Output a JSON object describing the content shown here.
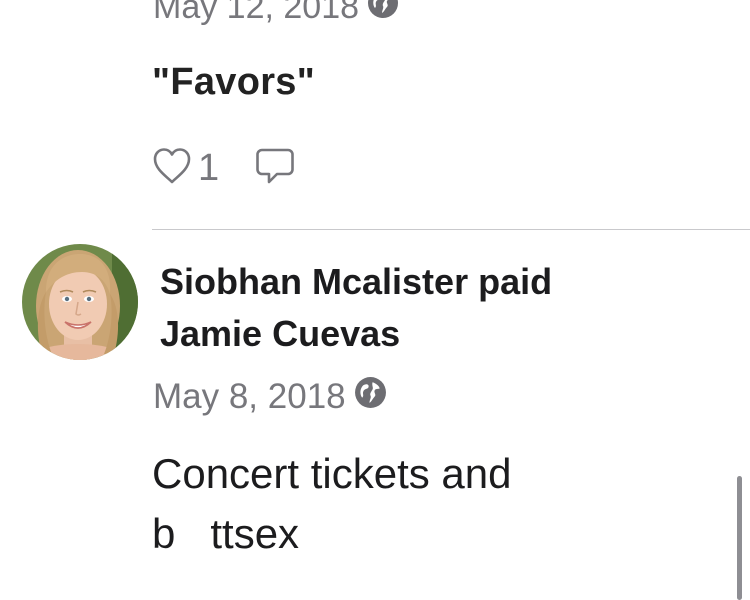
{
  "feed": {
    "item1": {
      "date": "May 12, 2018",
      "privacy_icon": "globe-icon",
      "note": "\"Favors\"",
      "like_count": "1",
      "like_icon": "heart-outline-icon",
      "comment_icon": "speech-bubble-icon"
    },
    "item2": {
      "title": "Siobhan Mcalister paid Jamie Cuevas",
      "date": "May 8, 2018",
      "privacy_icon": "globe-icon",
      "note": "Concert tickets and b   ttsex"
    }
  },
  "colors": {
    "text_primary": "#1c1c1e",
    "text_secondary": "#77777c",
    "divider": "#c9c9cc",
    "background": "#ffffff"
  }
}
